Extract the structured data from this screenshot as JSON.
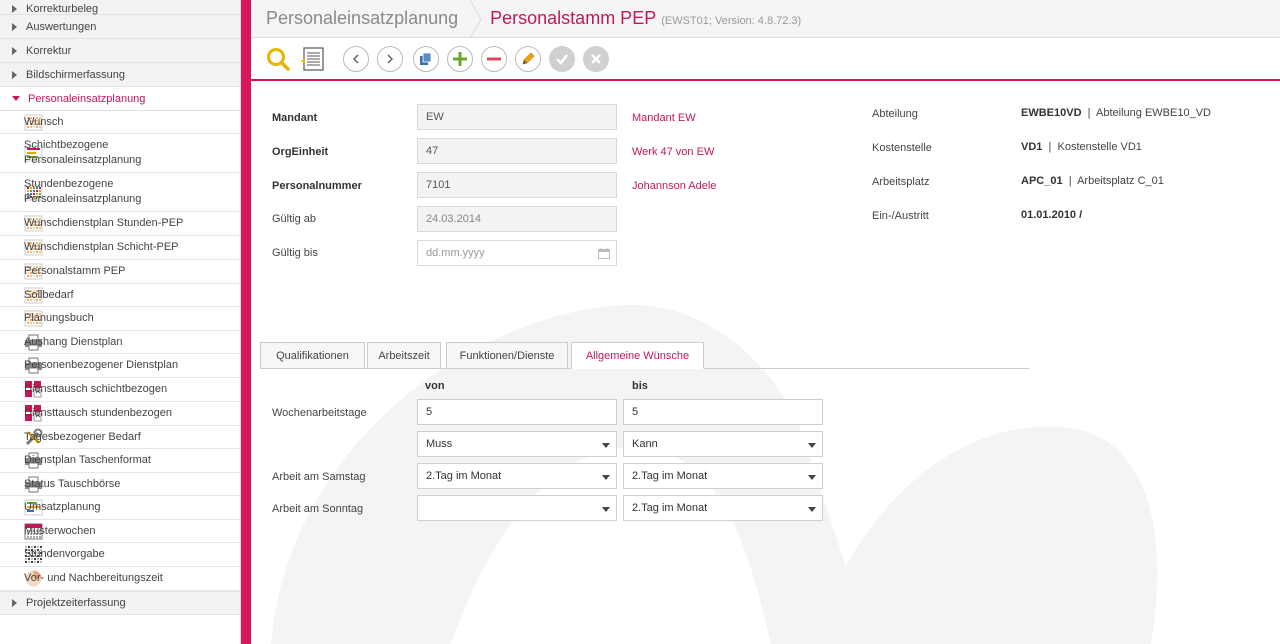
{
  "sidebar": {
    "sections_top": [
      {
        "label": "Korrekturbeleg"
      },
      {
        "label": "Auswertungen"
      },
      {
        "label": "Korrektur"
      },
      {
        "label": "Bildschirmerfassung"
      },
      {
        "label": "Personaleinsatzplanung"
      }
    ],
    "items": [
      {
        "label": "Wunsch",
        "icon": "calendar-grid-icon"
      },
      {
        "label": "Schichtbezogene\nPersonaleinsatzplanung",
        "icon": "shift-plan-icon"
      },
      {
        "label": "Stundenbezogene\nPersonaleinsatzplanung",
        "icon": "hour-plan-icon"
      },
      {
        "label": "Wunschdienstplan Stunden-PEP",
        "icon": "calendar-grid-icon"
      },
      {
        "label": "Wunschdienstplan Schicht-PEP",
        "icon": "calendar-grid-icon"
      },
      {
        "label": "Personalstamm PEP",
        "icon": "calendar-grid-icon"
      },
      {
        "label": "Sollbedarf",
        "icon": "calendar-grid-icon"
      },
      {
        "label": "Planungsbuch",
        "icon": "calendar-grid-icon"
      },
      {
        "label": "Aushang Dienstplan",
        "icon": "printer-icon"
      },
      {
        "label": "Personenbezogener Dienstplan",
        "icon": "printer-icon"
      },
      {
        "label": "Diensttausch schichtbezogen",
        "icon": "swap-icon"
      },
      {
        "label": "Diensttausch stundenbezogen",
        "icon": "swap-icon"
      },
      {
        "label": "Tagesbezogener Bedarf",
        "icon": "tools-icon"
      },
      {
        "label": "Dienstplan Taschenformat",
        "icon": "printer-icon"
      },
      {
        "label": "Status Tauschbörse",
        "icon": "printer-icon"
      },
      {
        "label": "Umsatzplanung",
        "icon": "chart-grid-icon"
      },
      {
        "label": "Musterwochen",
        "icon": "calendar-icon"
      },
      {
        "label": "Stundenvorgabe",
        "icon": "dotted-grid-icon"
      },
      {
        "label": "Vor- und Nachbereitungszeit",
        "icon": "pie-icon"
      }
    ],
    "sections_bottom": [
      {
        "label": "Projektzeiterfassung"
      }
    ]
  },
  "header": {
    "breadcrumb_parent": "Personaleinsatzplanung",
    "title": "Personalstamm PEP",
    "version": "(EWST01; Version: 4.8.72.3)"
  },
  "toolbar": {
    "icons": [
      "search-icon",
      "list-icon",
      "prev-icon",
      "next-icon",
      "copy-icon",
      "add-icon",
      "remove-icon",
      "edit-icon",
      "confirm-icon",
      "cancel-icon"
    ]
  },
  "form": {
    "mandant_label": "Mandant",
    "mandant_value": "EW",
    "mandant_link": "Mandant EW",
    "org_label": "OrgEinheit",
    "org_value": "47",
    "org_link": "Werk 47 von EW",
    "pers_label": "Personalnummer",
    "pers_value": "7101",
    "pers_link": "Johannson Adele",
    "gueltig_ab_label": "Gültig ab",
    "gueltig_ab_value": "24.03.2014",
    "gueltig_bis_label": "Gültig bis",
    "gueltig_bis_placeholder": "dd.mm.yyyy"
  },
  "right_info": {
    "abteilung_label": "Abteilung",
    "abteilung_code": "EWBE10VD",
    "abteilung_name": "Abteilung EWBE10_VD",
    "kostenstelle_label": "Kostenstelle",
    "kostenstelle_code": "VD1",
    "kostenstelle_name": "Kostenstelle VD1",
    "arbeitsplatz_label": "Arbeitsplatz",
    "arbeitsplatz_code": "APC_01",
    "arbeitsplatz_name": "Arbeitsplatz C_01",
    "einaustritt_label": "Ein-/Austritt",
    "einaustritt_value": "01.01.2010 /",
    "separator": "|"
  },
  "tabs": [
    {
      "label": "Qualifikationen"
    },
    {
      "label": "Arbeitszeit"
    },
    {
      "label": "Funktionen/Dienste"
    },
    {
      "label": "Allgemeine Wünsche"
    }
  ],
  "wishes": {
    "col_von": "von",
    "col_bis": "bis",
    "wochenarbeitstage_label": "Wochenarbeitstage",
    "wochen_von": "5",
    "wochen_bis": "5",
    "muss_value": "Muss",
    "kann_value": "Kann",
    "samstag_label": "Arbeit am Samstag",
    "samstag_von": "2.Tag im Monat",
    "samstag_bis": "2.Tag im Monat",
    "sonntag_label": "Arbeit am Sonntag",
    "sonntag_von": "",
    "sonntag_bis": "2.Tag im Monat"
  },
  "colors": {
    "accent": "#d6175f",
    "link": "#c2185b"
  }
}
